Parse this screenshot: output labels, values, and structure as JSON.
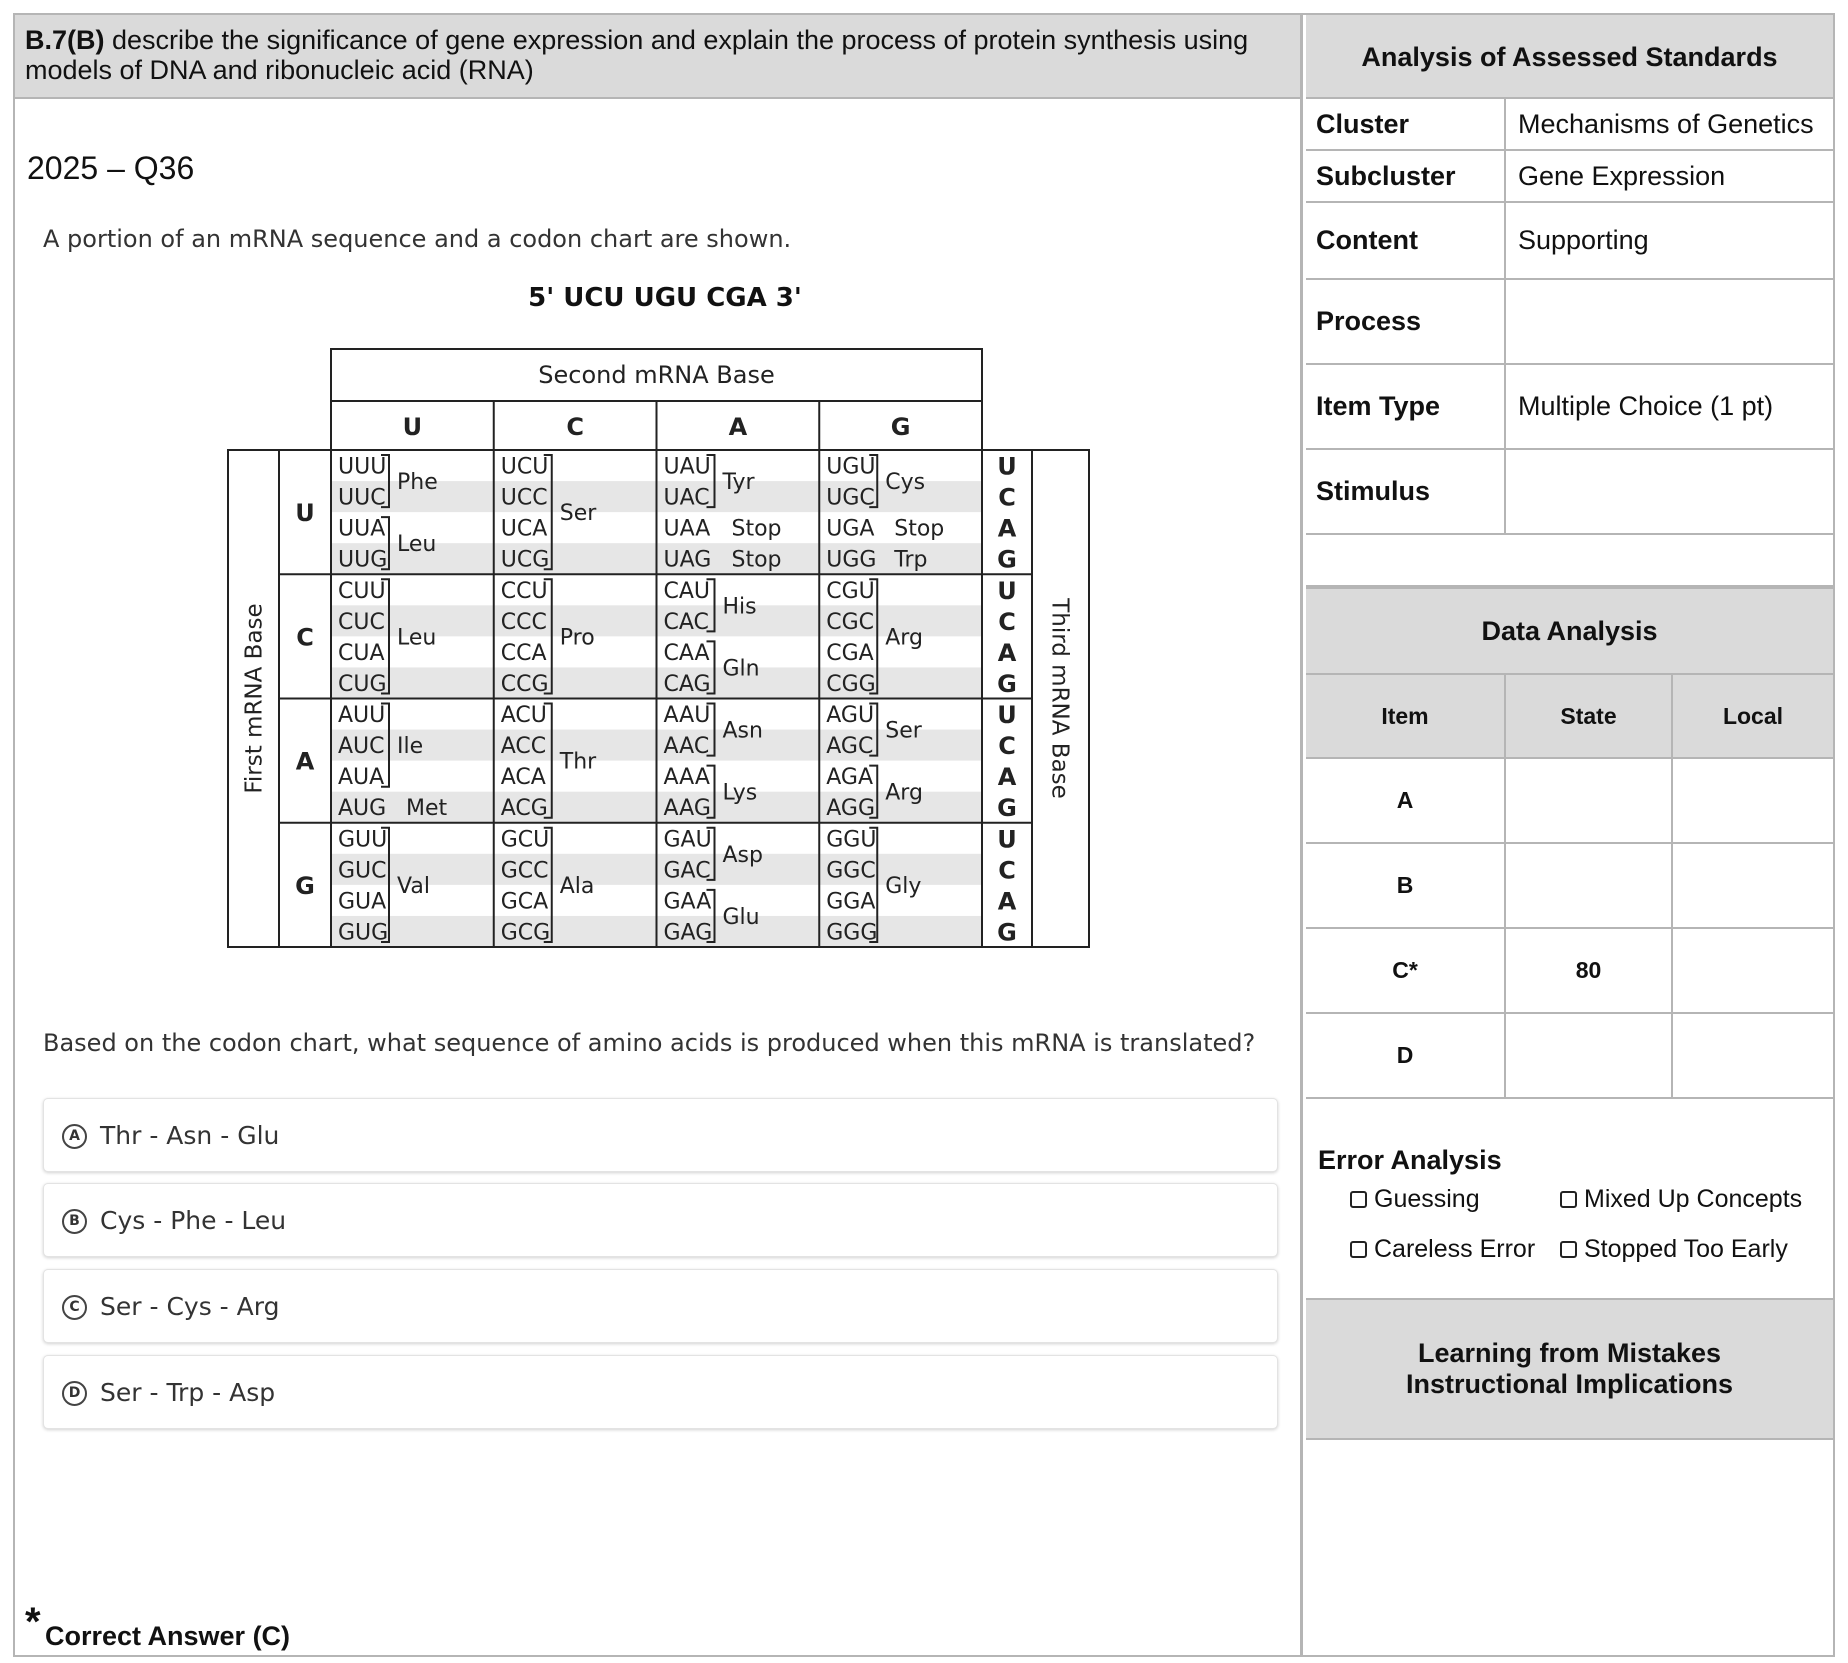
{
  "standard": {
    "code": "B.7(B)",
    "text": " describe the significance of gene expression and explain the process of protein synthesis using models of DNA and ribonucleic acid (RNA)"
  },
  "question": {
    "number": "2025 – Q36",
    "prompt": "A portion of an mRNA sequence and a codon chart are shown.",
    "mrna": "5' UCU UGU CGA 3'",
    "stem": "Based on the codon chart, what sequence of amino acids is produced when this mRNA is translated?",
    "choices": [
      {
        "letter": "A",
        "text": "Thr - Asn - Glu"
      },
      {
        "letter": "B",
        "text": "Cys - Phe - Leu"
      },
      {
        "letter": "C",
        "text": "Ser - Cys - Arg"
      },
      {
        "letter": "D",
        "text": "Ser - Trp - Asp"
      }
    ],
    "answer_star": "*",
    "answer": "Correct Answer (C)"
  },
  "codon_chart": {
    "second_label": "Second mRNA Base",
    "first_label": "First mRNA Base",
    "third_label": "Third mRNA Base",
    "bases": [
      "U",
      "C",
      "A",
      "G"
    ],
    "cells": [
      [
        {
          "codons": [
            "UUU",
            "UUC",
            "UUA",
            "UUG"
          ],
          "aa": [
            {
              "name": "Phe",
              "rows": [
                0,
                1
              ]
            },
            {
              "name": "Leu",
              "rows": [
                2,
                3
              ]
            }
          ]
        },
        {
          "codons": [
            "UCU",
            "UCC",
            "UCA",
            "UCG"
          ],
          "aa": [
            {
              "name": "Ser",
              "rows": [
                0,
                3
              ]
            }
          ]
        },
        {
          "codons": [
            "UAU",
            "UAC",
            "UAA",
            "UAG"
          ],
          "aa": [
            {
              "name": "Tyr",
              "rows": [
                0,
                1
              ]
            },
            {
              "name": "Stop",
              "rows": [
                2,
                2
              ]
            },
            {
              "name": "Stop",
              "rows": [
                3,
                3
              ]
            }
          ]
        },
        {
          "codons": [
            "UGU",
            "UGC",
            "UGA",
            "UGG"
          ],
          "aa": [
            {
              "name": "Cys",
              "rows": [
                0,
                1
              ]
            },
            {
              "name": "Stop",
              "rows": [
                2,
                2
              ]
            },
            {
              "name": "Trp",
              "rows": [
                3,
                3
              ]
            }
          ]
        }
      ],
      [
        {
          "codons": [
            "CUU",
            "CUC",
            "CUA",
            "CUG"
          ],
          "aa": [
            {
              "name": "Leu",
              "rows": [
                0,
                3
              ]
            }
          ]
        },
        {
          "codons": [
            "CCU",
            "CCC",
            "CCA",
            "CCG"
          ],
          "aa": [
            {
              "name": "Pro",
              "rows": [
                0,
                3
              ]
            }
          ]
        },
        {
          "codons": [
            "CAU",
            "CAC",
            "CAA",
            "CAG"
          ],
          "aa": [
            {
              "name": "His",
              "rows": [
                0,
                1
              ]
            },
            {
              "name": "Gln",
              "rows": [
                2,
                3
              ]
            }
          ]
        },
        {
          "codons": [
            "CGU",
            "CGC",
            "CGA",
            "CGG"
          ],
          "aa": [
            {
              "name": "Arg",
              "rows": [
                0,
                3
              ]
            }
          ]
        }
      ],
      [
        {
          "codons": [
            "AUU",
            "AUC",
            "AUA",
            "AUG"
          ],
          "aa": [
            {
              "name": "Ile",
              "rows": [
                0,
                2
              ]
            },
            {
              "name": "Met",
              "rows": [
                3,
                3
              ]
            }
          ]
        },
        {
          "codons": [
            "ACU",
            "ACC",
            "ACA",
            "ACG"
          ],
          "aa": [
            {
              "name": "Thr",
              "rows": [
                0,
                3
              ]
            }
          ]
        },
        {
          "codons": [
            "AAU",
            "AAC",
            "AAA",
            "AAG"
          ],
          "aa": [
            {
              "name": "Asn",
              "rows": [
                0,
                1
              ]
            },
            {
              "name": "Lys",
              "rows": [
                2,
                3
              ]
            }
          ]
        },
        {
          "codons": [
            "AGU",
            "AGC",
            "AGA",
            "AGG"
          ],
          "aa": [
            {
              "name": "Ser",
              "rows": [
                0,
                1
              ]
            },
            {
              "name": "Arg",
              "rows": [
                2,
                3
              ]
            }
          ]
        }
      ],
      [
        {
          "codons": [
            "GUU",
            "GUC",
            "GUA",
            "GUG"
          ],
          "aa": [
            {
              "name": "Val",
              "rows": [
                0,
                3
              ]
            }
          ]
        },
        {
          "codons": [
            "GCU",
            "GCC",
            "GCA",
            "GCG"
          ],
          "aa": [
            {
              "name": "Ala",
              "rows": [
                0,
                3
              ]
            }
          ]
        },
        {
          "codons": [
            "GAU",
            "GAC",
            "GAA",
            "GAG"
          ],
          "aa": [
            {
              "name": "Asp",
              "rows": [
                0,
                1
              ]
            },
            {
              "name": "Glu",
              "rows": [
                2,
                3
              ]
            }
          ]
        },
        {
          "codons": [
            "GGU",
            "GGC",
            "GGA",
            "GGG"
          ],
          "aa": [
            {
              "name": "Gly",
              "rows": [
                0,
                3
              ]
            }
          ]
        }
      ]
    ]
  },
  "analysis": {
    "title": "Analysis of Assessed Standards",
    "meta": [
      {
        "label": "Cluster",
        "value": "Mechanisms of Genetics"
      },
      {
        "label": "Subcluster",
        "value": "Gene Expression"
      },
      {
        "label": "Content",
        "value": "Supporting"
      },
      {
        "label": "Process",
        "value": ""
      },
      {
        "label": "Item Type",
        "value": "Multiple Choice (1 pt)"
      },
      {
        "label": "Stimulus",
        "value": ""
      }
    ],
    "data_title": "Data Analysis",
    "data_headers": [
      "Item",
      "State",
      "Local"
    ],
    "data_rows": [
      {
        "item": "A",
        "state": "",
        "local": ""
      },
      {
        "item": "B",
        "state": "",
        "local": ""
      },
      {
        "item": "C*",
        "state": "80",
        "local": ""
      },
      {
        "item": "D",
        "state": "",
        "local": ""
      }
    ],
    "error_title": "Error Analysis",
    "error_options": [
      "Guessing",
      "Mixed Up Concepts",
      "Careless Error",
      "Stopped Too Early"
    ],
    "learning_title_1": "Learning from Mistakes",
    "learning_title_2": "Instructional Implications"
  }
}
